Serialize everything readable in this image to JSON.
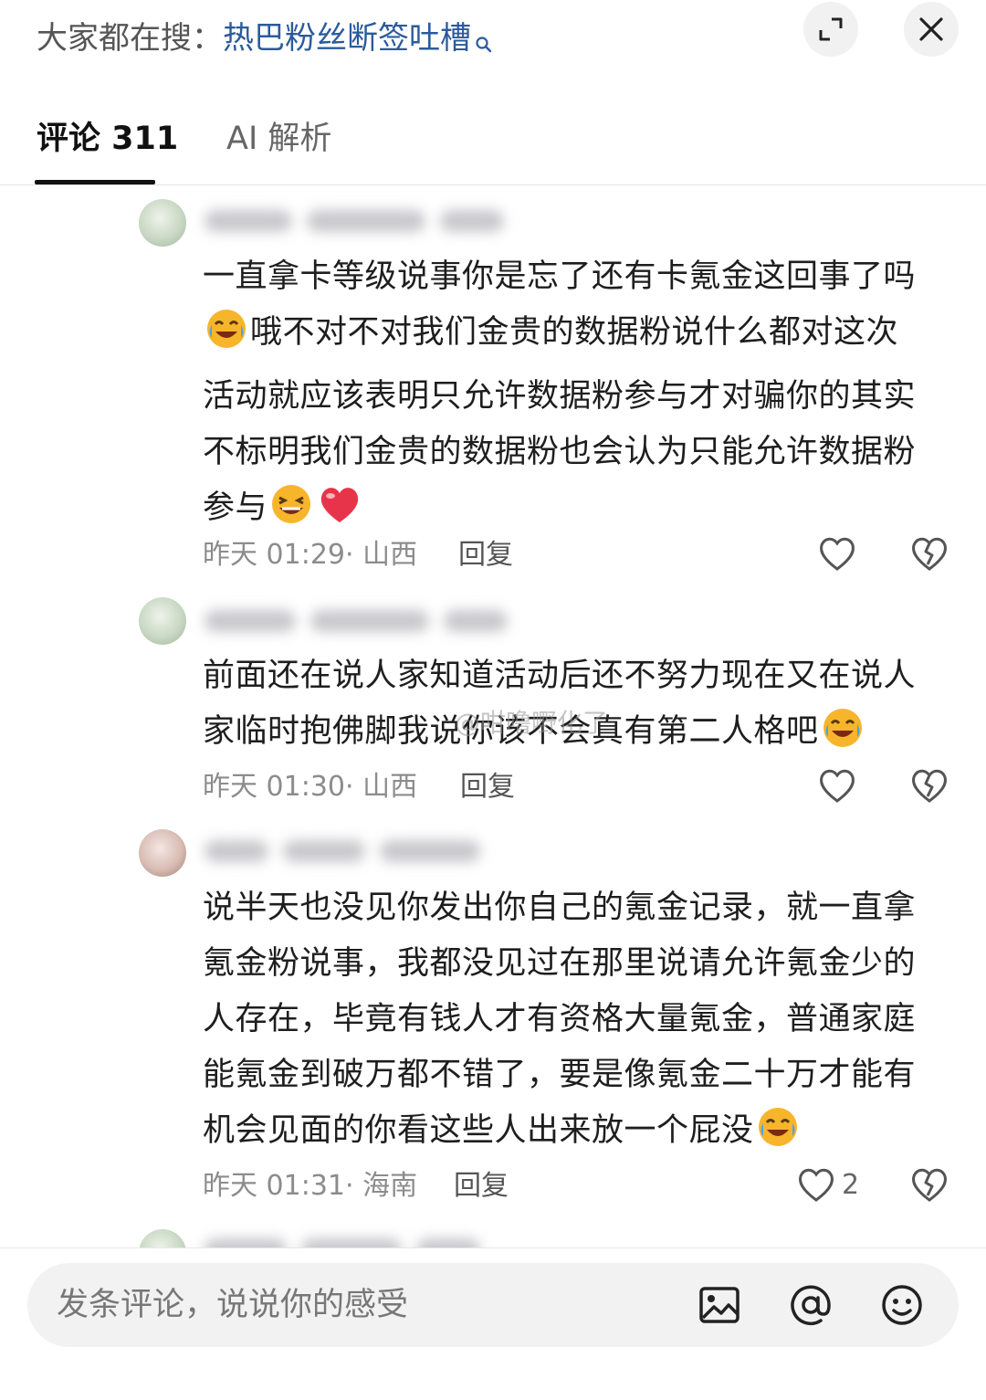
{
  "header": {
    "search_prefix": "大家都在搜：",
    "search_term": "热巴粉丝断签吐槽",
    "search_icon": "search-icon",
    "expand_icon": "expand-icon",
    "close_icon": "close-icon"
  },
  "tabs": [
    {
      "label": "评论 311",
      "active": true
    },
    {
      "label": "AI 解析",
      "active": false
    }
  ],
  "comments": [
    {
      "text_lines": [
        "一直拿卡等级说事你是忘了还有卡氪金这回事了吗",
        "哦不对不对我们金贵的数据粉说什么都对这次",
        "活动就应该表明只允许数据粉参与才对骗你的其实",
        "不标明我们金贵的数据粉也会认为只能允许数据粉",
        "参与"
      ],
      "time": "昨天 01:29· 山西",
      "reply_label": "回复",
      "likes": ""
    },
    {
      "text_lines": [
        "前面还在说人家知道活动后还不努力现在又在说人",
        "家临时抱佛脚我说你该不会真有第二人格吧"
      ],
      "time": "昨天 01:30· 山西",
      "reply_label": "回复",
      "likes": ""
    },
    {
      "text_lines": [
        "说半天也没见你发出你自己的氪金记录，就一直拿",
        "氪金粉说事，我都没见过在那里说请允许氪金少的",
        "人存在，毕竟有钱人才有资格大量氪金，普通家庭",
        "能氪金到破万都不错了，要是像氪金二十万才能有",
        "机会见面的你看这些人出来放一个屁没"
      ],
      "time": "昨天 01:31· 海南",
      "reply_label": "回复",
      "likes": "2"
    }
  ],
  "watermark": "@咁噜嘢化了",
  "composer": {
    "placeholder": "发条评论，说说你的感受",
    "icons": [
      "image-icon",
      "at-icon",
      "emoji-icon"
    ]
  },
  "colors": {
    "search_term": "#2b5b9c",
    "heart_emoji": "#e8344a",
    "emoji_face": "#f7b52c"
  }
}
